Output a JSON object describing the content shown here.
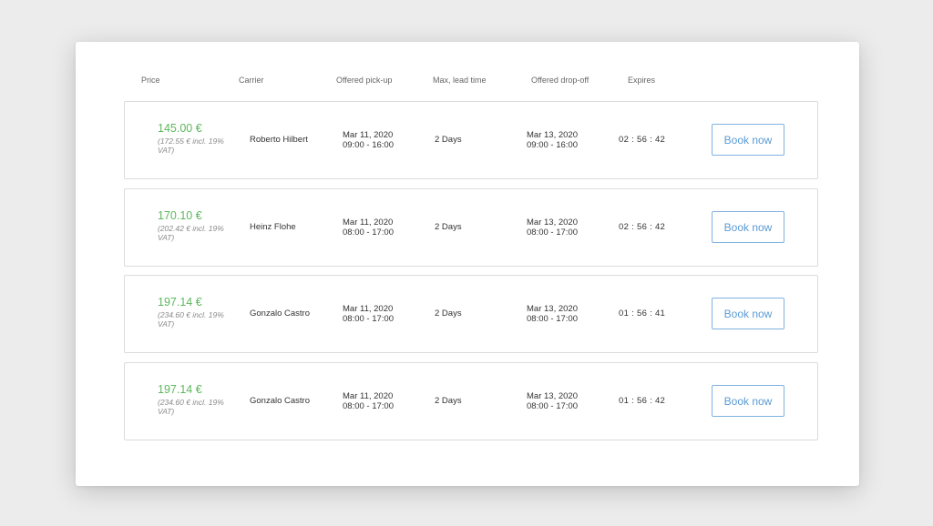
{
  "header": {
    "price": "Price",
    "carrier": "Carrier",
    "pickup": "Offered pick-up",
    "lead_time": "Max, lead time",
    "dropoff": "Offered drop-off",
    "expires": "Expires"
  },
  "offers": [
    {
      "price": "145.00 €",
      "vat_line1": "(172.55 € incl. 19%",
      "vat_line2": "VAT)",
      "carrier": "Roberto Hilbert",
      "pickup_date": "Mar 11, 2020",
      "pickup_time": "09:00 - 16:00",
      "lead_time": "2 Days",
      "dropoff_date": "Mar 13, 2020",
      "dropoff_time": "09:00 - 16:00",
      "expires": "02 : 56 : 42",
      "button": "Book now"
    },
    {
      "price": "170.10 €",
      "vat_line1": "(202.42 € incl. 19%",
      "vat_line2": "VAT)",
      "carrier": "Heinz Flohe",
      "pickup_date": "Mar 11, 2020",
      "pickup_time": "08:00 - 17:00",
      "lead_time": "2 Days",
      "dropoff_date": "Mar 13, 2020",
      "dropoff_time": "08:00 - 17:00",
      "expires": "02 : 56 : 42",
      "button": "Book now"
    },
    {
      "price": "197.14 €",
      "vat_line1": "(234.60 € incl. 19%",
      "vat_line2": "VAT)",
      "carrier": "Gonzalo Castro",
      "pickup_date": "Mar 11, 2020",
      "pickup_time": "08:00 - 17:00",
      "lead_time": "2 Days",
      "dropoff_date": "Mar 13, 2020",
      "dropoff_time": "08:00 - 17:00",
      "expires": "01 : 56 : 41",
      "button": "Book now"
    },
    {
      "price": "197.14 €",
      "vat_line1": "(234.60 € incl. 19%",
      "vat_line2": "VAT)",
      "carrier": "Gonzalo Castro",
      "pickup_date": "Mar 11, 2020",
      "pickup_time": "08:00 - 17:00",
      "lead_time": "2 Days",
      "dropoff_date": "Mar 13, 2020",
      "dropoff_time": "08:00 - 17:00",
      "expires": "01 : 56 : 42",
      "button": "Book now"
    }
  ],
  "colors": {
    "price": "#5cb85c",
    "button_border": "#7fb2e0",
    "button_text": "#5b9bd5"
  }
}
